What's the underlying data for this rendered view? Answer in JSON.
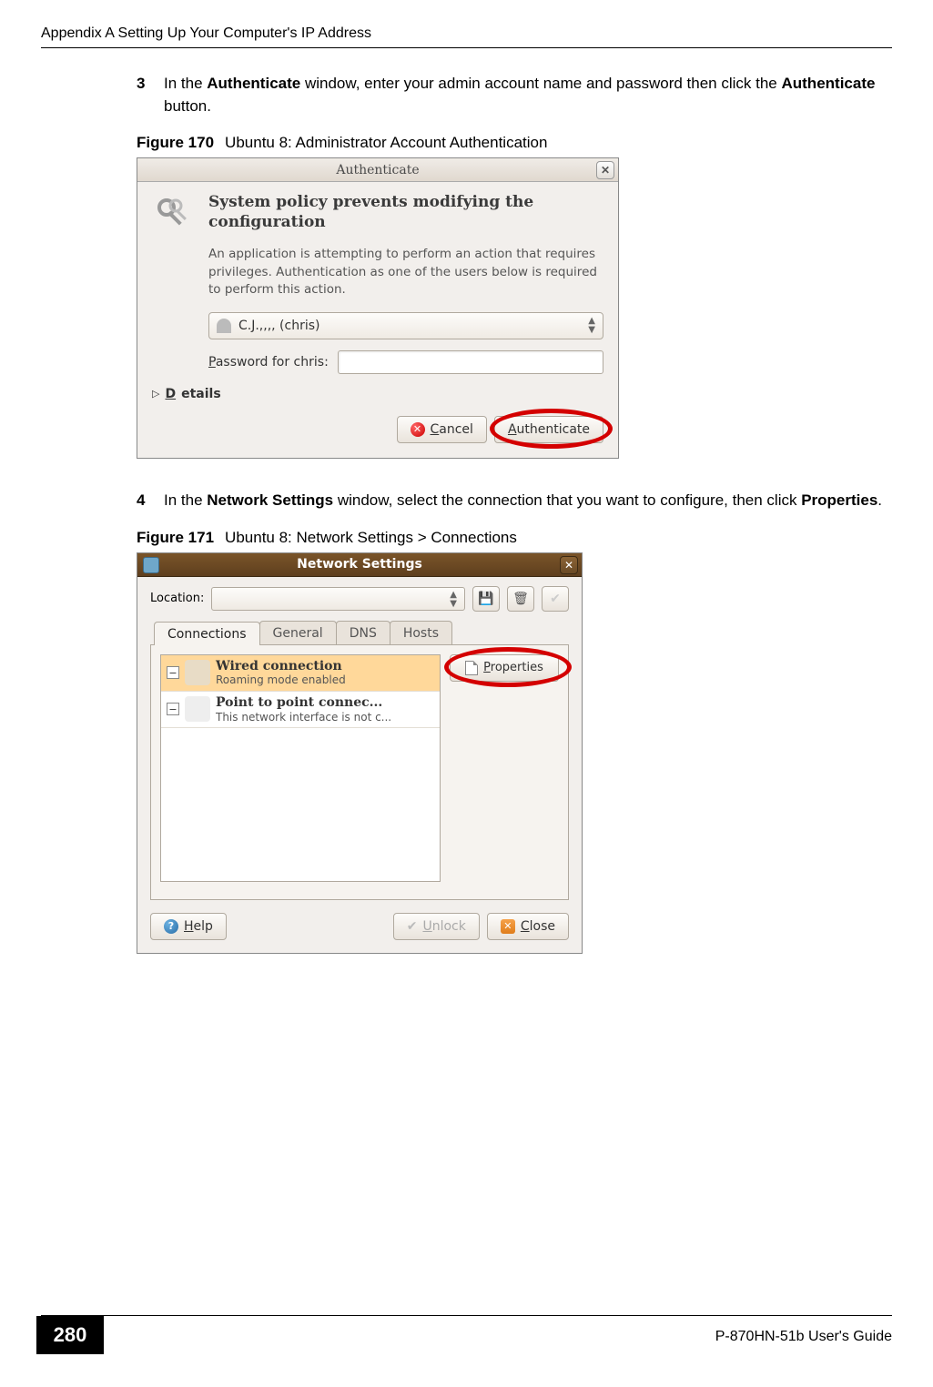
{
  "header": {
    "text": "Appendix A Setting Up Your Computer's IP Address"
  },
  "steps": {
    "s3": {
      "num": "3",
      "pre": "In the ",
      "b1": "Authenticate",
      "mid": " window, enter your admin account name and password then click the ",
      "b2": "Authenticate",
      "post": " button."
    },
    "s4": {
      "num": "4",
      "pre": "In the ",
      "b1": "Network Settings",
      "mid": " window, select the connection that you want to configure, then click ",
      "b2": "Properties",
      "post": "."
    }
  },
  "fig170": {
    "label": "Figure 170",
    "caption": "Ubuntu 8: Administrator Account Authentication"
  },
  "fig171": {
    "label": "Figure 171",
    "caption": "Ubuntu 8: Network Settings > Connections"
  },
  "auth": {
    "title": "Authenticate",
    "heading": "System policy prevents modifying the configuration",
    "desc": "An application is attempting to perform an action that requires privileges. Authentication as one of the users below is required to perform this action.",
    "user": "C.J.,,,, (chris)",
    "pw_label_pre": "P",
    "pw_label_mid": "assword for chris:",
    "details_label": "Details",
    "cancel": "Cancel",
    "authenticate": "Authenticate"
  },
  "net": {
    "title": "Network Settings",
    "location_label": "Location:",
    "tabs": [
      "Connections",
      "General",
      "DNS",
      "Hosts"
    ],
    "wired_title": "Wired connection",
    "wired_sub": "Roaming mode enabled",
    "ppp_title": "Point to point connec...",
    "ppp_sub": "This network interface is not c...",
    "properties": "Properties",
    "help": "Help",
    "unlock": "Unlock",
    "close": "Close"
  },
  "footer": {
    "page": "280",
    "guide": "P-870HN-51b User's Guide"
  }
}
